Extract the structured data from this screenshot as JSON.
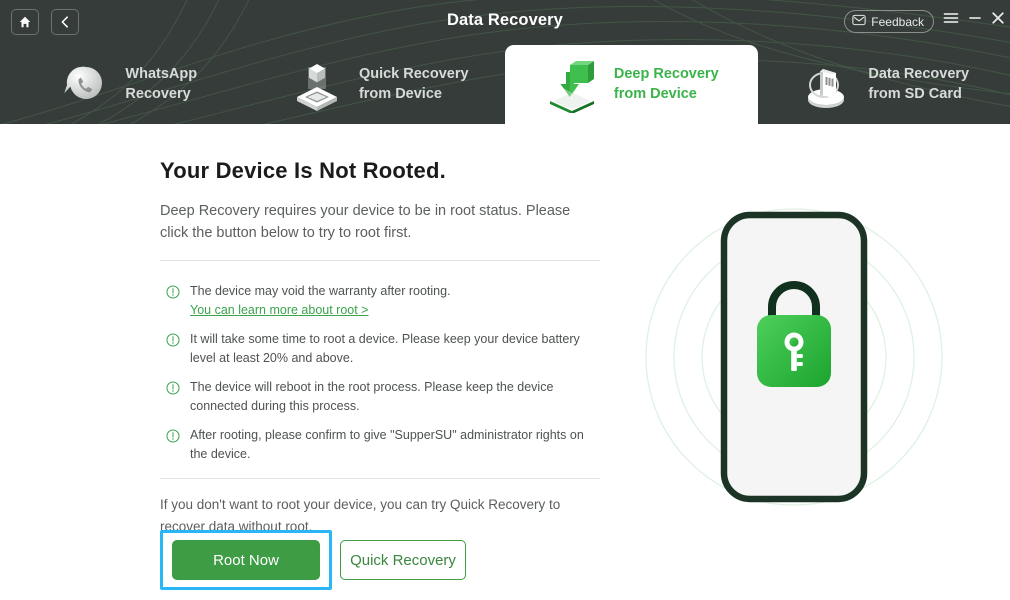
{
  "window": {
    "title": "Data Recovery",
    "home_icon": "home-icon",
    "back_icon": "chevron-left-icon",
    "feedback_label": "Feedback",
    "feedback_icon": "envelope-icon",
    "menu_icon": "hamburger-menu-icon",
    "minimize_icon": "minimize-icon",
    "close_icon": "close-icon"
  },
  "tabs": [
    {
      "label": "WhatsApp\nRecovery",
      "icon": "whatsapp-bubble-icon",
      "active": false
    },
    {
      "label": "Quick Recovery\nfrom Device",
      "icon": "cube-platform-icon",
      "active": false
    },
    {
      "label": "Deep Recovery\nfrom Device",
      "icon": "green-box-download-icon",
      "active": true
    },
    {
      "label": "Data Recovery\nfrom SD Card",
      "icon": "sd-card-icon",
      "active": false
    }
  ],
  "main": {
    "title": "Your Device Is Not Rooted.",
    "subtitle": "Deep Recovery requires your device to be in root status. Please click the button below to try to root first.",
    "notes": [
      {
        "text": "The device may void the warranty after rooting.",
        "link": "You can learn more about root >",
        "icon": "exclamation-circle-icon"
      },
      {
        "text": "It will take some time to root a device. Please keep your device battery level at least 20% and above.",
        "link": "",
        "icon": "exclamation-circle-icon"
      },
      {
        "text": "The device will reboot in the root process. Please keep the device connected during this process.",
        "link": "",
        "icon": "exclamation-circle-icon"
      },
      {
        "text": "After rooting, please confirm to give \"SupperSU\" administrator rights on the device.",
        "link": "",
        "icon": "exclamation-circle-icon"
      }
    ],
    "footnote": "If you don't want to root your device, you can try Quick Recovery to recover data without root.",
    "primary_button": "Root Now",
    "secondary_button": "Quick Recovery"
  },
  "illustration": {
    "name": "phone-with-lock-illustration",
    "lock_icon": "padlock-key-icon"
  },
  "colors": {
    "header_bg": "#353c39",
    "accent_green": "#3ab44a",
    "button_green": "#3d9c44",
    "highlight_blue": "#29b6f6",
    "phone_outline": "#1b3425"
  }
}
